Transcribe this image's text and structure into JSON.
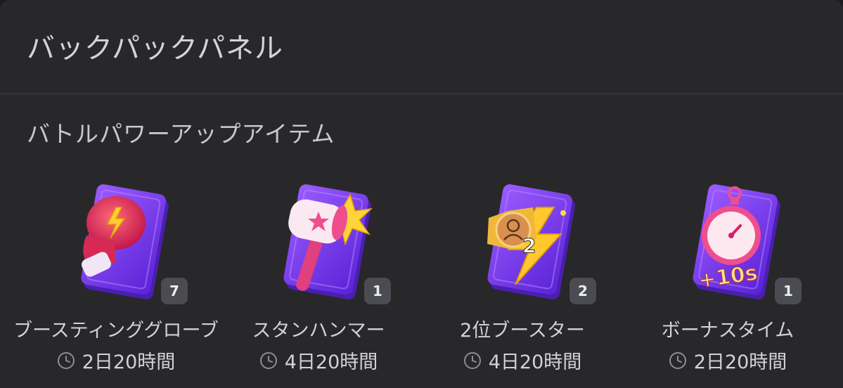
{
  "header": {
    "title": "バックパックパネル"
  },
  "section": {
    "title": "バトルパワーアップアイテム"
  },
  "items": [
    {
      "name": "ブースティンググローブ",
      "quantity": "7",
      "time": "2日20時間",
      "icon": "boxing-glove-icon"
    },
    {
      "name": "スタンハンマー",
      "quantity": "1",
      "time": "4日20時間",
      "icon": "hammer-icon"
    },
    {
      "name": "2位ブースター",
      "quantity": "2",
      "time": "4日20時間",
      "icon": "booster-badge-icon",
      "art_label": "2"
    },
    {
      "name": "ボーナスタイム",
      "quantity": "1",
      "time": "2日20時間",
      "icon": "stopwatch-icon",
      "art_label": "+10s"
    }
  ],
  "colors": {
    "card": "#7b3cf0",
    "badge": "#4b4b52",
    "background": "#28282a"
  }
}
